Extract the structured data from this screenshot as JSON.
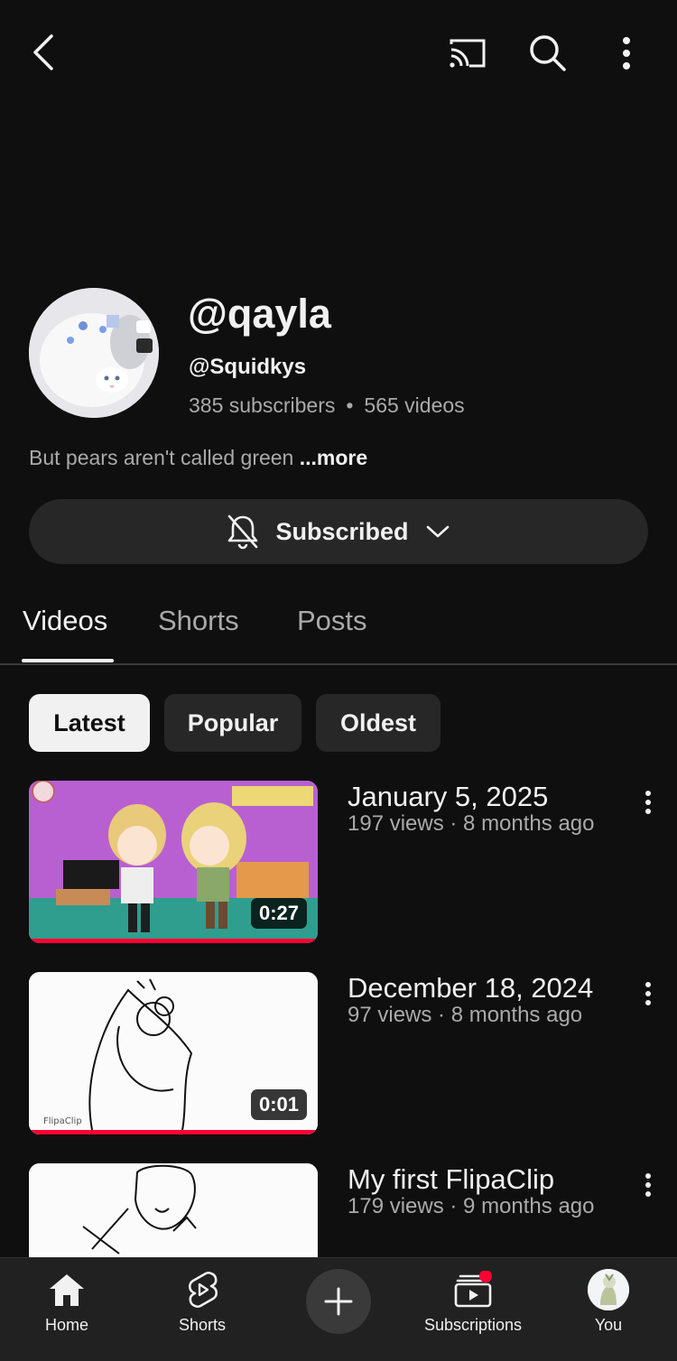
{
  "topbar": {
    "back_icon": "chevron-left-icon",
    "cast_icon": "cast-icon",
    "search_icon": "search-icon",
    "more_icon": "more-vertical-icon"
  },
  "channel": {
    "name": "@qayla",
    "handle": "@Squidkys",
    "subscribers": "385 subscribers",
    "separator": "•",
    "videos": "565 videos",
    "description": "But pears aren't called green",
    "more_label": "...more"
  },
  "subscribe": {
    "label": "Subscribed",
    "bell_icon": "bell-off-icon",
    "chevron_icon": "chevron-down-icon"
  },
  "tabs": [
    {
      "label": "Videos",
      "active": true
    },
    {
      "label": "Shorts",
      "active": false
    },
    {
      "label": "Posts",
      "active": false
    }
  ],
  "filters": [
    {
      "label": "Latest",
      "selected": true
    },
    {
      "label": "Popular",
      "selected": false
    },
    {
      "label": "Oldest",
      "selected": false
    }
  ],
  "videos": [
    {
      "title": "January 5, 2025",
      "meta": "197 views · 8 months ago",
      "duration": "0:27",
      "watched": 1.0
    },
    {
      "title": "December 18, 2024",
      "meta": "97 views · 8 months ago",
      "duration": "0:01",
      "watched": 1.0
    },
    {
      "title": "My first FlipaClip",
      "meta": "179 views · 9 months ago",
      "duration": "",
      "watched": 0
    }
  ],
  "bottom_nav": {
    "home": "Home",
    "shorts": "Shorts",
    "create_icon": "plus-icon",
    "subscriptions": "Subscriptions",
    "you": "You"
  },
  "colors": {
    "background": "#0f0f0f",
    "surface": "#272727",
    "progress": "#ff0033",
    "notification_dot": "#ff0033"
  }
}
